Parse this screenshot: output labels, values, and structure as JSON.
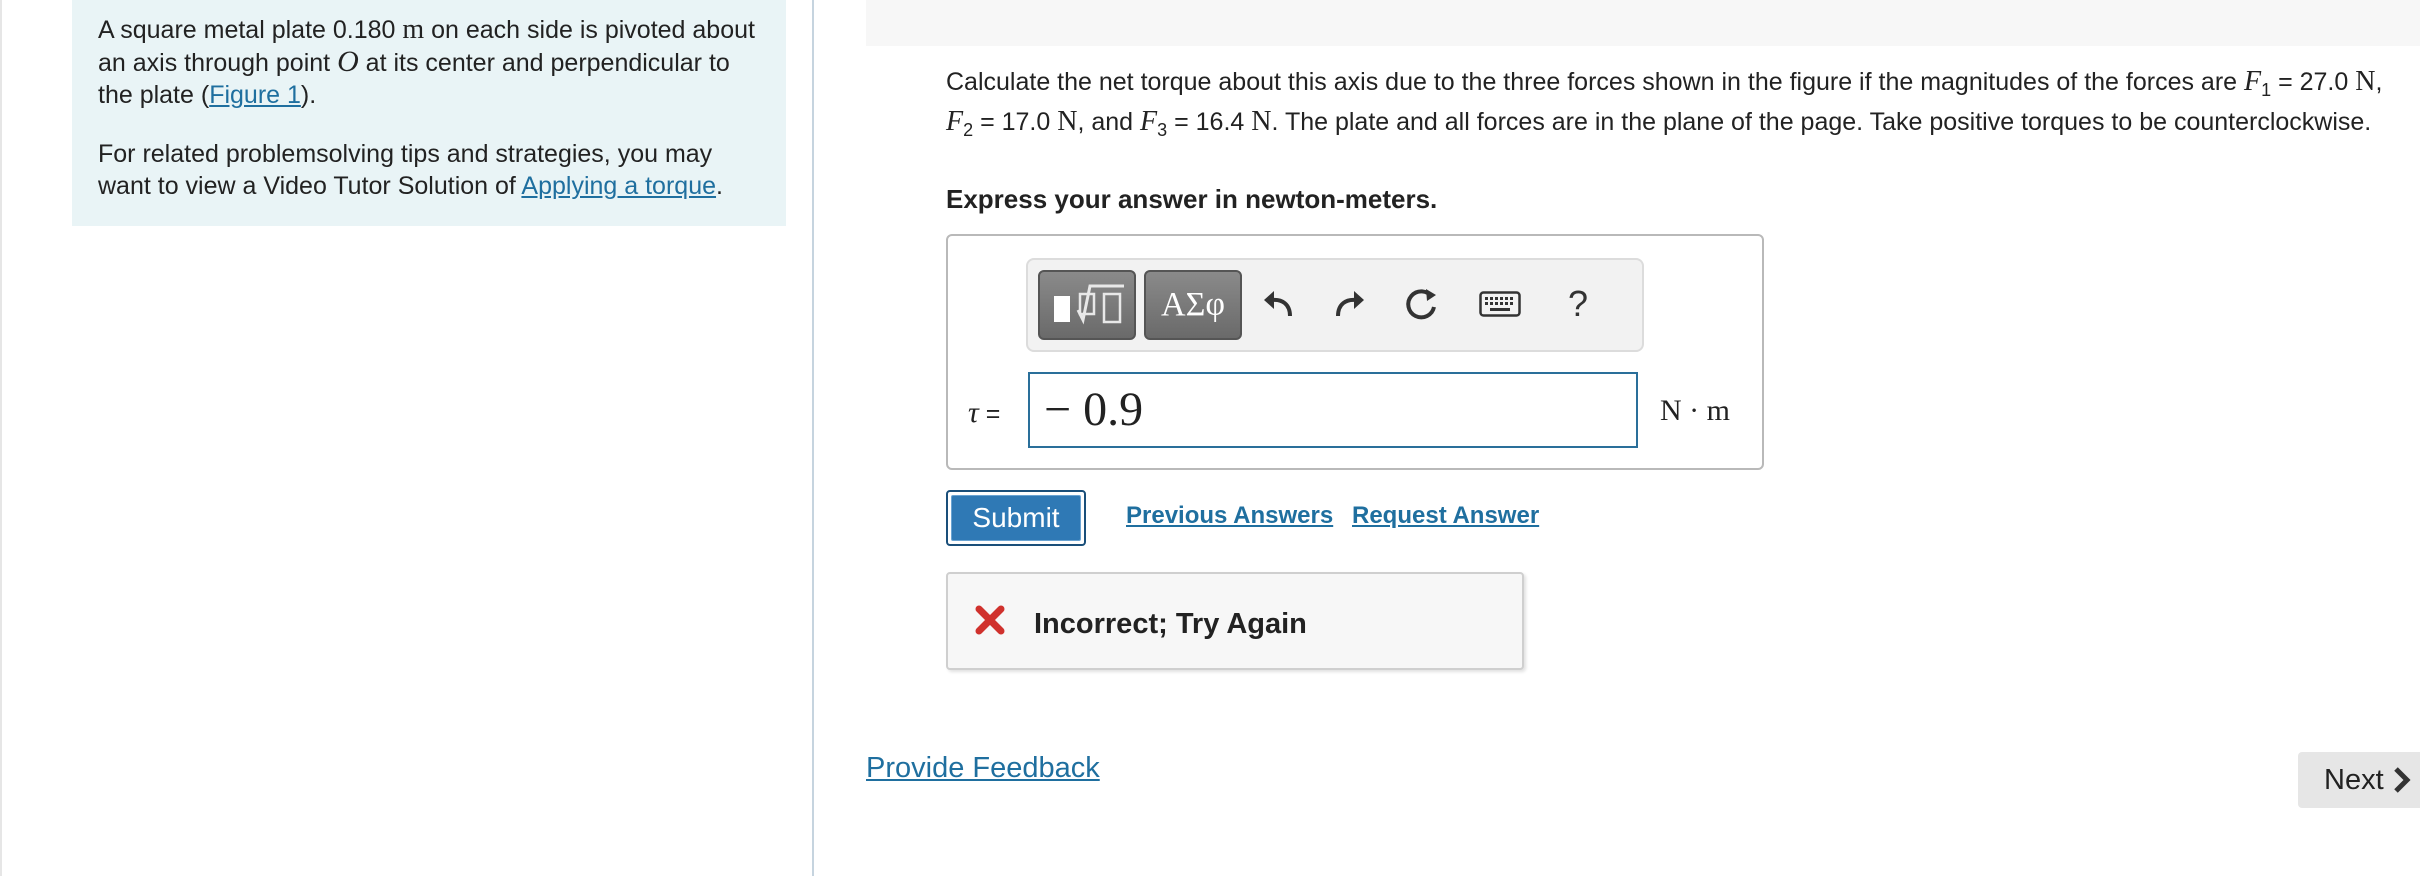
{
  "left_panel": {
    "intro_a": "A square metal plate 0.180",
    "intro_unit": "m",
    "intro_b": " on each side is pivoted about an axis through point ",
    "intro_point": "O",
    "intro_c": " at its center and perpendicular to the plate (",
    "figure_link": "Figure 1",
    "intro_d": ").",
    "tips_text": "For related problemsolving tips and strategies, you may want to view a Video Tutor Solution of ",
    "tips_link": "Applying a torque",
    "tips_end": "."
  },
  "question": {
    "text_a": "Calculate the net torque about this axis due to the three forces shown in the figure if the magnitudes of the forces are ",
    "f1_sym": "F",
    "f1_sub": "1",
    "f1_eq": " = 27.0 ",
    "f1_unit": "N",
    "sep1": ", ",
    "f2_sym": "F",
    "f2_sub": "2",
    "f2_eq": " = 17.0 ",
    "f2_unit": "N",
    "sep2": ", and ",
    "f3_sym": "F",
    "f3_sub": "3",
    "f3_eq": " = 16.4 ",
    "f3_unit": "N",
    "text_b": ". The plate and all forces are in the plane of the page. Take positive torques to be counterclockwise."
  },
  "instruction": "Express your answer in newton-meters.",
  "toolbar": {
    "greek_label": "ΑΣφ",
    "help_label": "?",
    "icons": [
      "templates-icon",
      "greek-symbols-icon",
      "undo-icon",
      "redo-icon",
      "reset-icon",
      "keyboard-icon",
      "help-icon"
    ]
  },
  "answer": {
    "variable": "τ",
    "equals": " =",
    "value": "− 0.9",
    "unit": "N · m"
  },
  "actions": {
    "submit_label": "Submit",
    "previous_answers_label": "Previous Answers",
    "request_answer_label": "Request Answer"
  },
  "feedback": {
    "message": "Incorrect; Try Again",
    "status_color": "#d0312d"
  },
  "footer": {
    "provide_feedback_label": "Provide Feedback",
    "next_label": "Next"
  },
  "colors": {
    "link": "#1f6f9f",
    "submit": "#2f79b5",
    "panel_bg": "#e9f4f6"
  }
}
